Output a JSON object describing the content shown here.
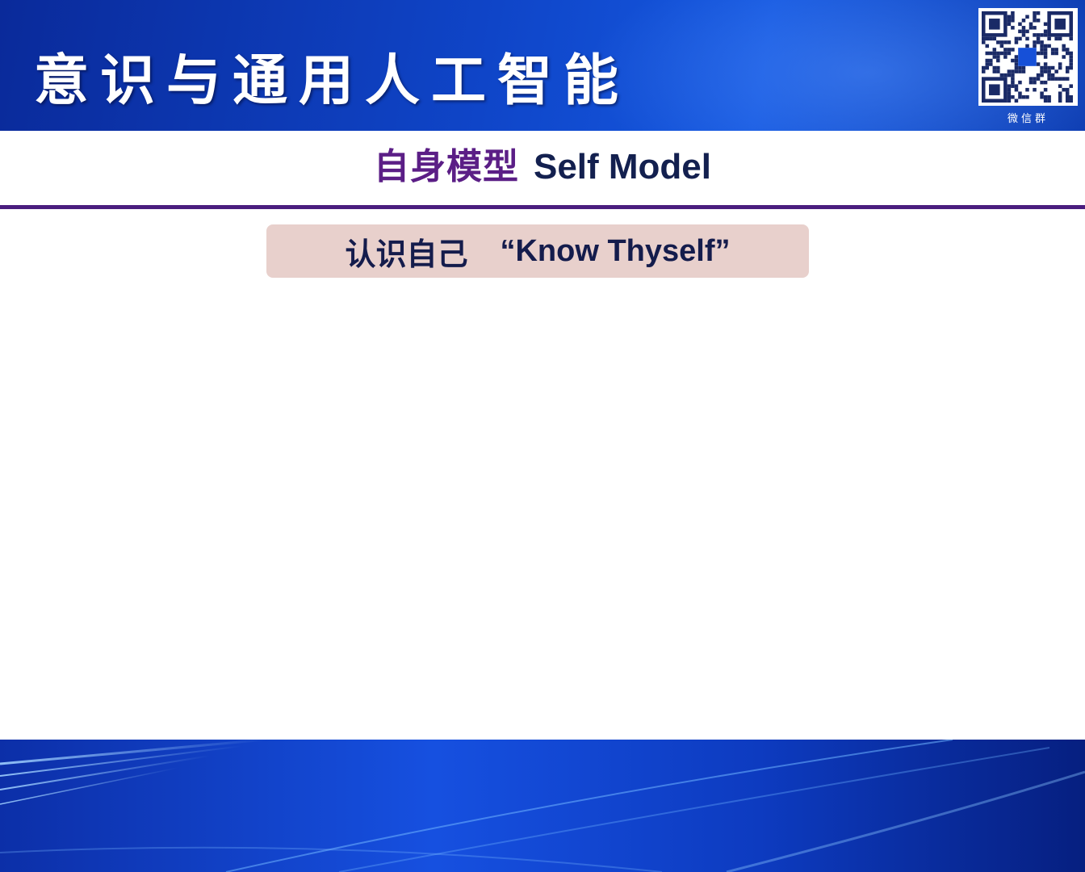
{
  "banner": {
    "title": "意识与通用人工智能",
    "qr_caption": "微信群",
    "qr_icon": "qr-code"
  },
  "slide": {
    "heading_cn": "自身模型",
    "heading_en": "Self Model",
    "subtitle_cn": "认识自己",
    "subtitle_en": "“Know Thyself”"
  },
  "colors": {
    "banner_blue": "#1048d0",
    "heading_purple": "#5b1e86",
    "heading_navy": "#13204f",
    "divider": "#4a1d7e",
    "subtitle_bg": "#e8d0cc"
  }
}
